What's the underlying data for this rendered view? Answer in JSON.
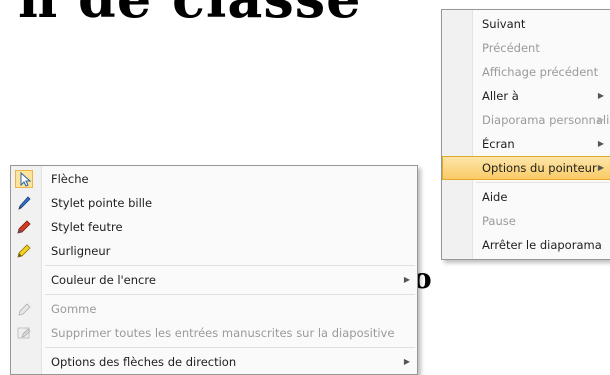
{
  "slide": {
    "title_fragment": "n de classe",
    "text_fragment": "o"
  },
  "context_menu": {
    "items": [
      {
        "label": "Suivant",
        "enabled": true
      },
      {
        "label": "Précédent",
        "enabled": false
      },
      {
        "label": "Affichage précédent",
        "enabled": false
      },
      {
        "label": "Aller à",
        "enabled": true,
        "submenu": true
      },
      {
        "label": "Diaporama personnalisé",
        "enabled": false,
        "submenu": true
      },
      {
        "label": "Écran",
        "enabled": true,
        "submenu": true
      },
      {
        "label": "Options du pointeur",
        "enabled": true,
        "submenu": true,
        "highlighted": true
      },
      {
        "label": "Aide",
        "enabled": true
      },
      {
        "label": "Pause",
        "enabled": false
      },
      {
        "label": "Arrêter le diaporama",
        "enabled": true
      }
    ]
  },
  "pointer_submenu": {
    "items": [
      {
        "label": "Flèche",
        "icon": "arrow-pointer-icon",
        "checked": true
      },
      {
        "label": "Stylet pointe bille",
        "icon": "ballpoint-pen-icon"
      },
      {
        "label": "Stylet feutre",
        "icon": "felt-tip-pen-icon"
      },
      {
        "label": "Surligneur",
        "icon": "highlighter-icon"
      },
      {
        "label": "Couleur de l'encre",
        "submenu": true
      },
      {
        "label": "Gomme",
        "icon": "eraser-icon",
        "enabled": false
      },
      {
        "label": "Supprimer toutes les entrées manuscrites sur la diapositive",
        "icon": "erase-all-icon",
        "enabled": false
      },
      {
        "label": "Options des flèches de direction",
        "submenu": true
      }
    ]
  },
  "colors": {
    "highlight_top": "#fde7ab",
    "highlight_bottom": "#f9c964",
    "highlight_border": "#e3a72c",
    "disabled_text": "#9a9a9a"
  }
}
